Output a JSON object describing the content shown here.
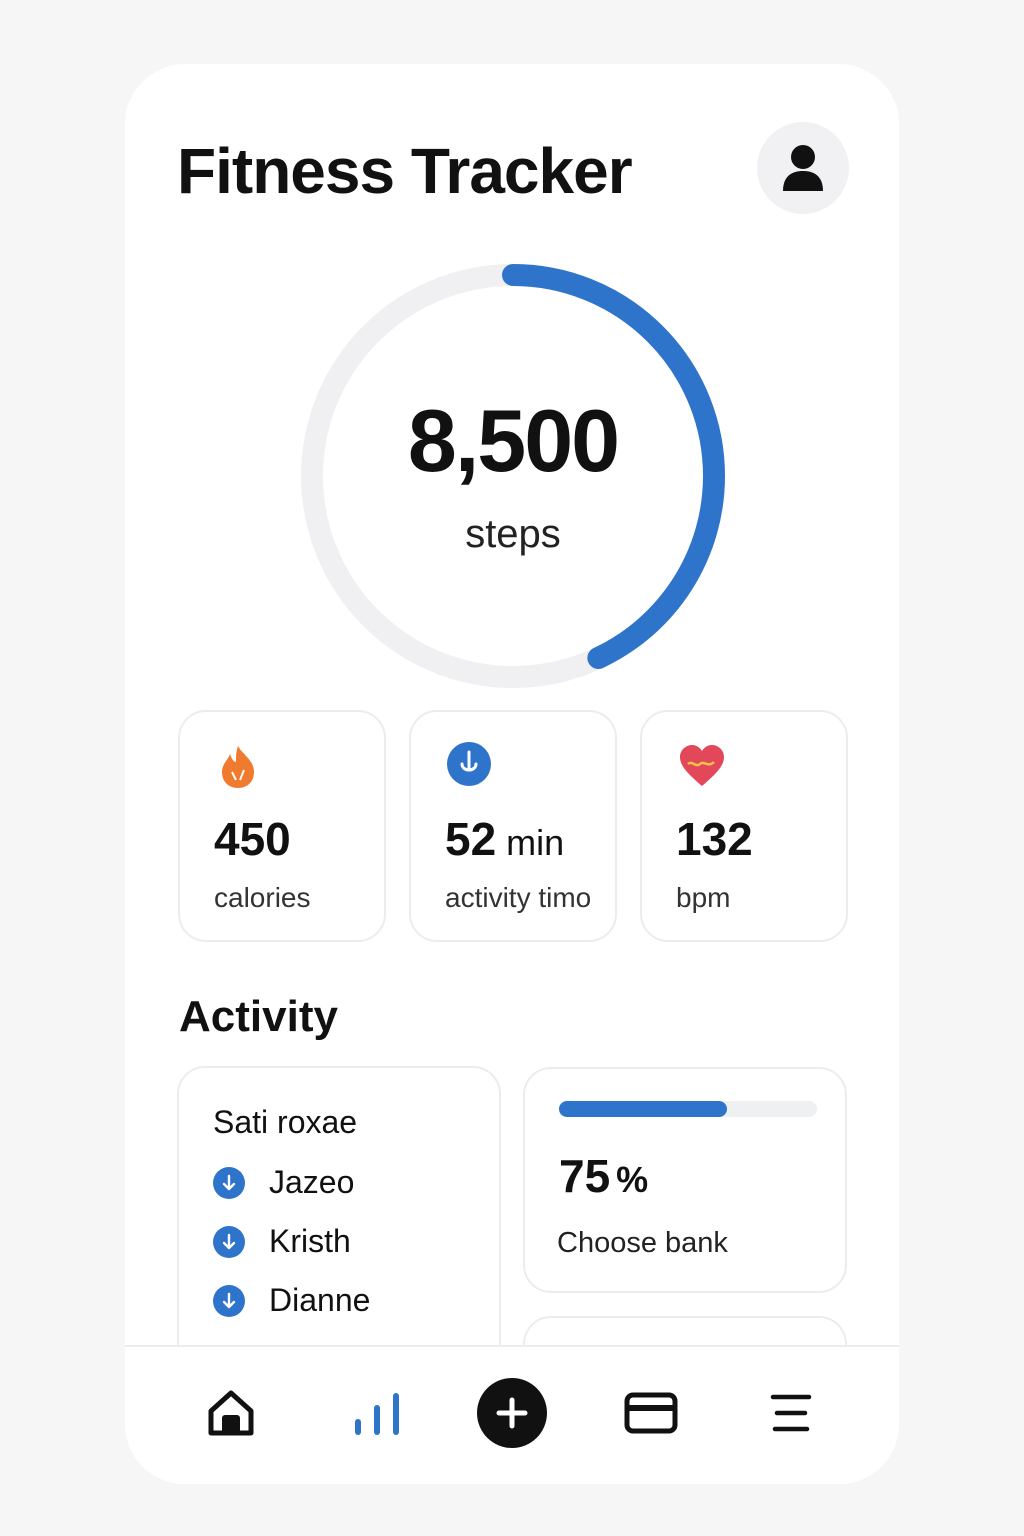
{
  "app": {
    "title": "Fitness Tracker"
  },
  "header": {
    "avatar_icon": "user-icon"
  },
  "steps": {
    "value": "8,500",
    "unit": "steps",
    "progress": 0.43,
    "color": "#2f74cb"
  },
  "stats": [
    {
      "icon": "flame-icon",
      "value": "450",
      "unit": "",
      "label": "calories",
      "color": "#f07a2e"
    },
    {
      "icon": "activity-icon",
      "value": "52",
      "unit": "min",
      "label": "activity timo",
      "color": "#2f74cb"
    },
    {
      "icon": "heart-icon",
      "value": "132",
      "unit": "",
      "label": "bpm",
      "color": "#e2475a"
    }
  ],
  "activity": {
    "title": "Activity",
    "list_header": "Sati roxae",
    "people": [
      {
        "name": "Jazeo",
        "icon": "arrow-down-icon"
      },
      {
        "name": "Kristh",
        "icon": "arrow-down-icon"
      },
      {
        "name": "Dianne",
        "icon": "arrow-down-icon"
      }
    ]
  },
  "progress": {
    "value": "75",
    "unit": "%",
    "fraction": 0.65,
    "label": "Choose bank"
  },
  "nav": [
    {
      "name": "home",
      "icon": "home-icon"
    },
    {
      "name": "stats",
      "icon": "bar-chart-icon"
    },
    {
      "name": "add",
      "icon": "plus-icon"
    },
    {
      "name": "wallet",
      "icon": "card-icon"
    },
    {
      "name": "menu",
      "icon": "menu-icon"
    }
  ]
}
